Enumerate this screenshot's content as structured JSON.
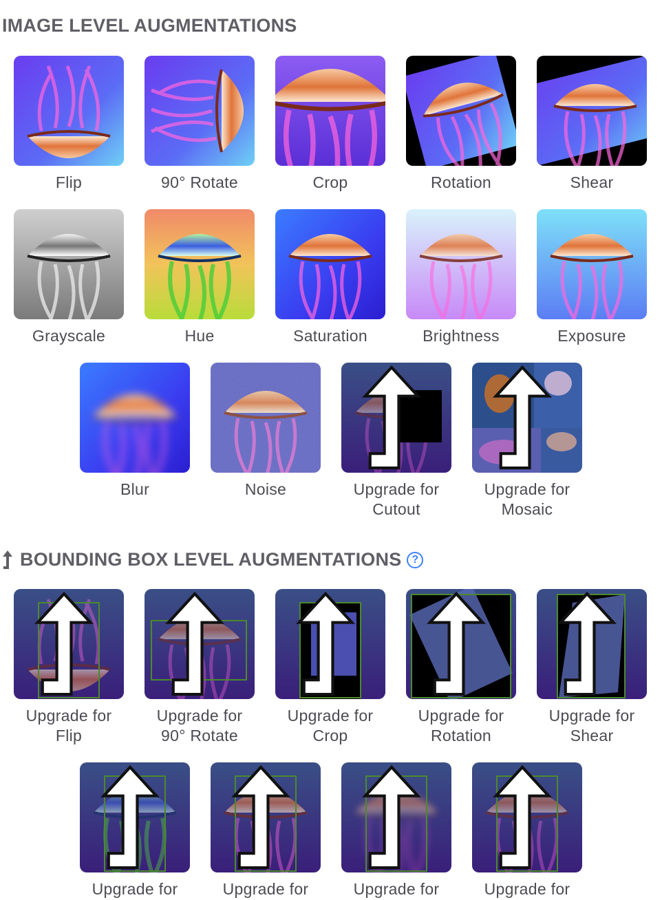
{
  "image_section": {
    "title": "IMAGE LEVEL AUGMENTATIONS"
  },
  "image_tiles": [
    {
      "label1": "Flip",
      "label2": ""
    },
    {
      "label1": "90° Rotate",
      "label2": ""
    },
    {
      "label1": "Crop",
      "label2": ""
    },
    {
      "label1": "Rotation",
      "label2": ""
    },
    {
      "label1": "Shear",
      "label2": ""
    },
    {
      "label1": "Grayscale",
      "label2": ""
    },
    {
      "label1": "Hue",
      "label2": ""
    },
    {
      "label1": "Saturation",
      "label2": ""
    },
    {
      "label1": "Brightness",
      "label2": ""
    },
    {
      "label1": "Exposure",
      "label2": ""
    },
    {
      "label1": "Blur",
      "label2": ""
    },
    {
      "label1": "Noise",
      "label2": ""
    },
    {
      "label1": "Upgrade for",
      "label2": "Cutout"
    },
    {
      "label1": "Upgrade for",
      "label2": "Mosaic"
    }
  ],
  "bbox_section": {
    "title": "BOUNDING BOX LEVEL AUGMENTATIONS",
    "help": "?"
  },
  "bbox_tiles": [
    {
      "label1": "Upgrade for",
      "label2": "Flip"
    },
    {
      "label1": "Upgrade for",
      "label2": "90° Rotate"
    },
    {
      "label1": "Upgrade for",
      "label2": "Crop"
    },
    {
      "label1": "Upgrade for",
      "label2": "Rotation"
    },
    {
      "label1": "Upgrade for",
      "label2": "Shear"
    },
    {
      "label1": "Upgrade for",
      "label2": ""
    },
    {
      "label1": "Upgrade for",
      "label2": ""
    },
    {
      "label1": "Upgrade for",
      "label2": ""
    },
    {
      "label1": "Upgrade for",
      "label2": ""
    }
  ]
}
